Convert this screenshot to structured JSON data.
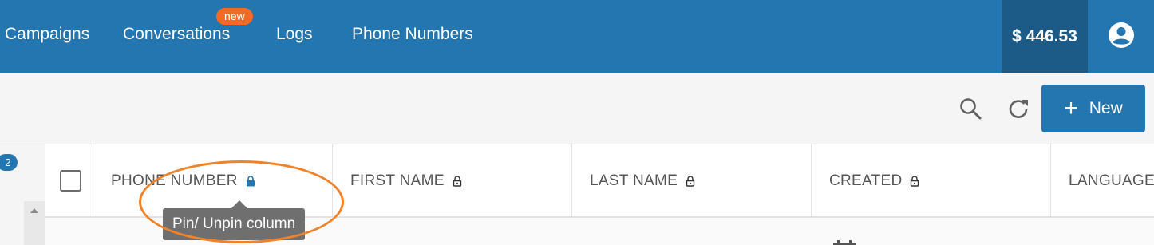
{
  "topnav": {
    "items": [
      {
        "label": "Campaigns"
      },
      {
        "label": "Conversations",
        "badge": "new"
      },
      {
        "label": "Logs"
      },
      {
        "label": "Phone Numbers"
      }
    ],
    "balance": "$ 446.53",
    "account_icon": "account-circle-icon"
  },
  "toolbar": {
    "search_icon": "search-icon",
    "refresh_icon": "refresh-icon",
    "new_button": {
      "icon": "plus-icon",
      "label": "New"
    }
  },
  "table": {
    "row_count_badge": "2",
    "columns": [
      {
        "label": "PHONE NUMBER",
        "pinned": true
      },
      {
        "label": "FIRST NAME",
        "pinned": false
      },
      {
        "label": "LAST NAME",
        "pinned": false
      },
      {
        "label": "CREATED",
        "pinned": false
      },
      {
        "label": "LANGUAGE",
        "pinned": false
      }
    ],
    "tooltip": "Pin/ Unpin column"
  },
  "colors": {
    "primary": "#2476b0",
    "primary_dark": "#1c5a87",
    "badge_orange": "#f26b21",
    "annotation": "#f0822a",
    "tooltip_bg": "#6f6f6f"
  }
}
